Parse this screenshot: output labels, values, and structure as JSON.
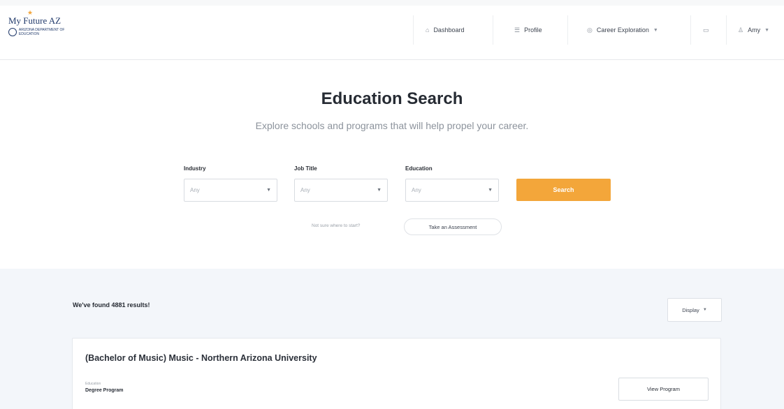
{
  "header": {
    "logo_title": "My Future AZ",
    "logo_subtitle": "ARIZONA DEPARTMENT OF EDUCATION",
    "nav": {
      "dashboard": "Dashboard",
      "profile": "Profile",
      "career_exploration": "Career Exploration",
      "user": "Amy"
    },
    "icons": {
      "dashboard": "dashboard-icon",
      "profile": "profile-icon",
      "career": "career-icon",
      "inbox": "inbox-icon",
      "user": "user-icon"
    }
  },
  "hero": {
    "title": "Education Search",
    "subtitle": "Explore schools and programs that will help propel your career."
  },
  "filters": {
    "industry": {
      "label": "Industry",
      "value": "Any"
    },
    "job_title": {
      "label": "Job Title",
      "value": "Any"
    },
    "education": {
      "label": "Education",
      "value": "Any"
    },
    "search_label": "Search",
    "not_sure": "Not sure where to start?",
    "assessment_label": "Take an Assessment"
  },
  "results": {
    "count_text": "We've found 4881 results!",
    "display_label": "Display",
    "items": [
      {
        "title": "(Bachelor of Music) Music - Northern Arizona University",
        "meta_label": "Education",
        "meta_value": "Degree Program",
        "button_label": "View Program"
      }
    ]
  },
  "colors": {
    "accent": "#f3a63a",
    "brand": "#213a6b",
    "results_bg": "#f3f6fa"
  }
}
